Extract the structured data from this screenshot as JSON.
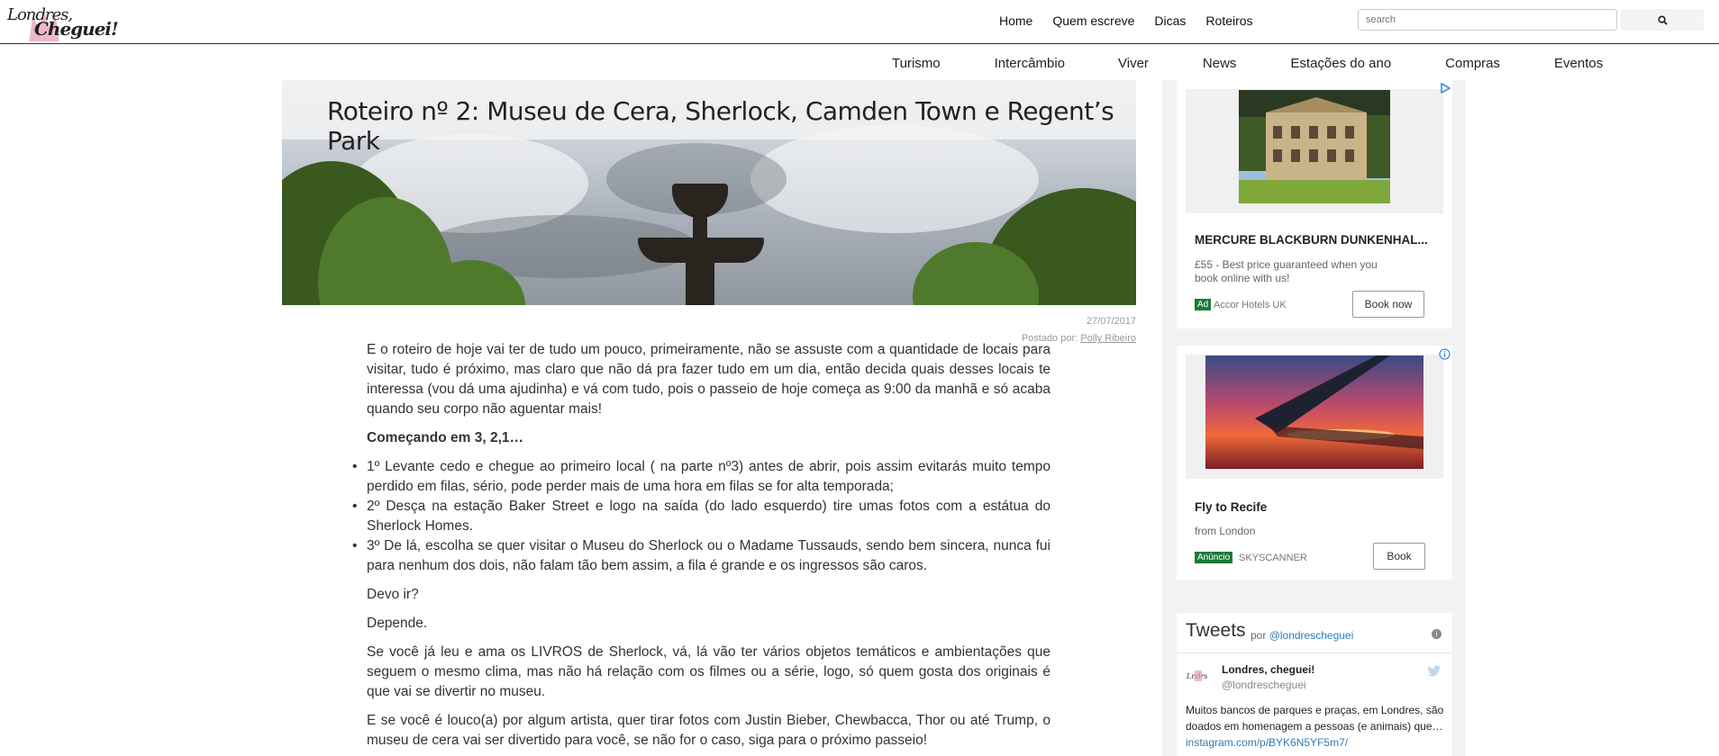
{
  "brand": {
    "logo_text_1": "Londres,",
    "logo_text_2": "Cheguei!"
  },
  "topnav": {
    "items": [
      "Home",
      "Quem escreve",
      "Dicas",
      "Roteiros"
    ]
  },
  "search": {
    "placeholder": "search"
  },
  "subnav": {
    "items": [
      "Turismo",
      "Intercâmbio",
      "Viver",
      "News",
      "Estações do ano",
      "Compras",
      "Eventos"
    ]
  },
  "post": {
    "title": "Roteiro nº 2: Museu de Cera, Sherlock, Camden Town e Regent’s Park",
    "date": "27/07/2017",
    "posted_by_label": "Postado por:",
    "author": "Polly Ribeiro",
    "paragraphs": {
      "intro": "E o roteiro de hoje vai ter de tudo um pouco, primeiramente, não se assuste com a quantidade de locais para visitar, tudo é próximo, mas claro que não dá pra fazer tudo em um dia, então decida quais desses locais te interessa (vou dá uma ajudinha) e vá com tudo, pois o passeio de hoje começa as 9:00 da manhã e só acaba quando seu corpo não aguentar mais!",
      "heading": "Começando em 3, 2,1…",
      "list": [
        "1º Levante cedo e chegue ao primeiro local ( na parte nº3) antes de abrir, pois assim evitarás muito tempo perdido em filas, sério, pode perder mais de uma hora em filas se for alta temporada;",
        "2º Desça na estação Baker Street e logo na saída (do lado esquerdo) tire umas fotos com a estátua do Sherlock Homes.",
        "3º De lá, escolha se quer visitar o Museu do Sherlock ou o Madame Tussauds, sendo bem sincera, nunca fui para nenhum dos dois, não falam tão bem assim, a fila é grande e os ingressos são caros."
      ],
      "q": "Devo ir?",
      "a": "Depende.",
      "p3": "Se você já leu e ama os LIVROS de Sherlock, vá, lá vão ter vários objetos temáticos e ambientações que seguem o mesmo clima, mas não há relação com os filmes ou a série, logo, só quem gosta dos originais é que vai se divertir no museu.",
      "p4": "E se você é louco(a) por algum artista, quer tirar fotos com Justin Bieber, Chewbacca, Thor ou até Trump, o museu de cera vai ser divertido para você, se não for o caso, siga para o próximo passeio!"
    }
  },
  "ads": [
    {
      "title": "MERCURE BLACKBURN DUNKENHAL...",
      "desc": "£55 - Best price guaranteed when you book online with us!",
      "badge": "Ad",
      "source": "Accor Hotels UK",
      "button": "Book now",
      "icon": "adchoice-play-icon"
    },
    {
      "title": "Fly to Recife",
      "desc": "from London",
      "badge": "Anúncio",
      "source": "SKYSCANNER",
      "button": "Book",
      "icon": "adchoice-info-icon"
    }
  ],
  "tweets": {
    "header": "Tweets",
    "by_label": "por",
    "handle_link": "@londrescheguei",
    "tweet": {
      "name": "Londres, cheguei!",
      "handle": "@londrescheguei",
      "text": "Muitos bancos de parques e praças, em Londres, são doados em homenagem a pessoas (e animais) que…",
      "link": "instagram.com/p/BYK6N5YF5m7/"
    }
  }
}
